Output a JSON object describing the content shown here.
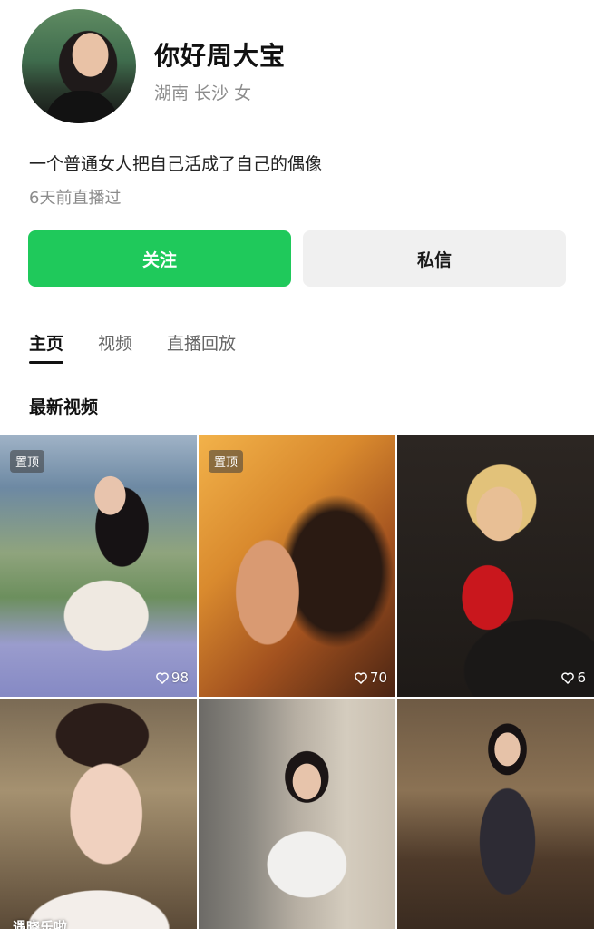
{
  "profile": {
    "name": "你好周大宝",
    "location": "湖南 长沙 女",
    "bio": "一个普通女人把自己活成了自己的偶像",
    "last_live": "6天前直播过"
  },
  "actions": {
    "follow_label": "关注",
    "message_label": "私信",
    "follow_color": "#1fc95b"
  },
  "tabs": [
    {
      "label": "主页",
      "active": true
    },
    {
      "label": "视频",
      "active": false
    },
    {
      "label": "直播回放",
      "active": false
    }
  ],
  "section_title": "最新视频",
  "videos": [
    {
      "pinned_label": "置顶",
      "likes": "98",
      "icon": "heart-icon"
    },
    {
      "pinned_label": "置顶",
      "likes": "70",
      "icon": "heart-icon"
    },
    {
      "likes": "6",
      "icon": "heart-icon"
    },
    {
      "caption": "遇晓乐啦"
    },
    {},
    {}
  ]
}
